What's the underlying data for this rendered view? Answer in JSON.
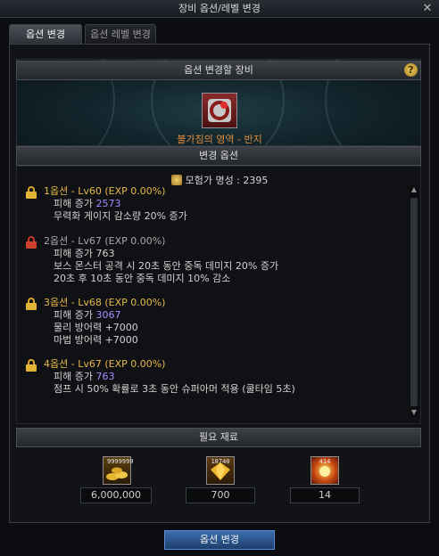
{
  "window": {
    "title": "장비 옵션/레벨 변경"
  },
  "tabs": [
    {
      "label": "옵션 변경"
    },
    {
      "label": "옵션 레벨 변경"
    }
  ],
  "equip_section": {
    "header": "옵션 변경할 장비",
    "item_name": "불가침의 영역 - 반지",
    "help_icon": "?"
  },
  "options_section": {
    "header": "변경 옵션",
    "fame_label": "모험가 명성 : 2395",
    "options": [
      {
        "title": "1옵션 - Lv60 (EXP 0.00%)",
        "lock": "gold",
        "damage_label": "피해 증가",
        "damage_value": "2573",
        "lines": [
          "무력화 게이지 감소량 20% 증가"
        ]
      },
      {
        "title": "2옵션 - Lv67 (EXP 0.00%)",
        "lock": "red",
        "damage_label": "피해 증가",
        "damage_value": "763",
        "lines": [
          "보스 몬스터 공격 시 20초 동안 중독 데미지 20% 증가",
          "20초 후 10초 동안 중독 데미지 10% 감소"
        ]
      },
      {
        "title": "3옵션 - Lv68 (EXP 0.00%)",
        "lock": "gold",
        "damage_label": "피해 증가",
        "damage_value": "3067",
        "lines": [
          "물리 방어력 +7000",
          "마법 방어력 +7000"
        ]
      },
      {
        "title": "4옵션 - Lv67 (EXP 0.00%)",
        "lock": "gold",
        "damage_label": "피해 증가",
        "damage_value": "763",
        "lines": [
          "점프 시 50% 확률로 3초 동안 슈퍼아머 적용 (쿨타임 5초)"
        ]
      }
    ]
  },
  "materials_section": {
    "header": "필요 재료",
    "items": [
      {
        "icon": "gold-coins-icon",
        "badge": "9999999",
        "count": "6,000,000"
      },
      {
        "icon": "gem-icon",
        "badge": "18740",
        "count": "700"
      },
      {
        "icon": "fire-stone-icon",
        "badge": "414",
        "count": "14"
      }
    ]
  },
  "action": {
    "button_label": "옵션 변경"
  },
  "colors": {
    "option_title_active": "#e7b84a",
    "option_title_locked": "#a9a9a9",
    "damage_value_highlight": "#a78cff",
    "item_name": "#e18a3c",
    "button": "#2b5590"
  }
}
